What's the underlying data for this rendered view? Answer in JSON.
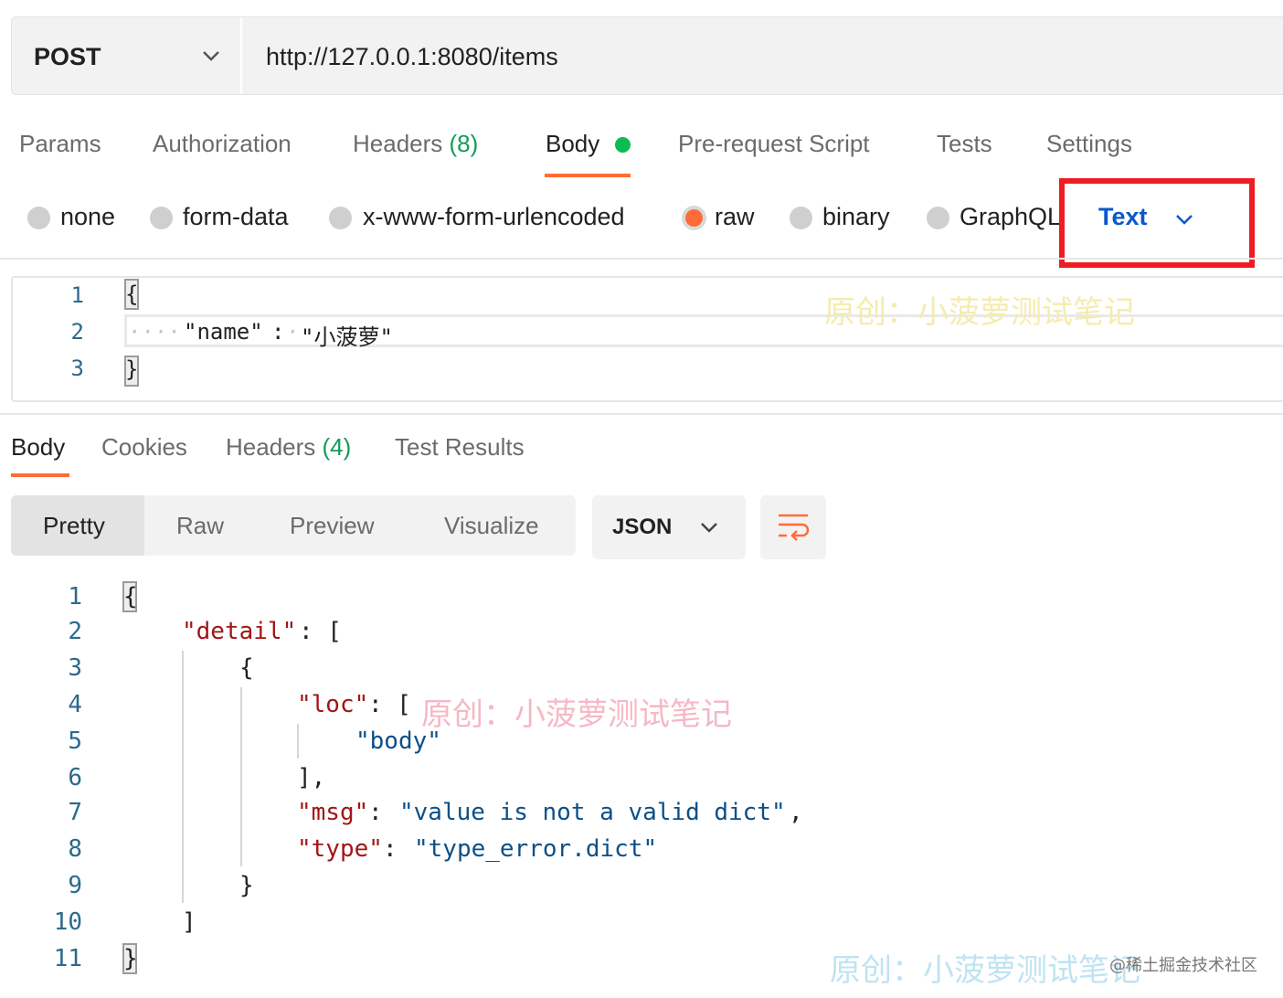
{
  "request": {
    "method": "POST",
    "url": "http://127.0.0.1:8080/items"
  },
  "request_tabs": [
    {
      "label": "Params"
    },
    {
      "label": "Authorization"
    },
    {
      "label": "Headers",
      "count": "(8)"
    },
    {
      "label": "Body",
      "active": true
    },
    {
      "label": "Pre-request Script"
    },
    {
      "label": "Tests"
    },
    {
      "label": "Settings"
    }
  ],
  "body_types": [
    {
      "label": "none",
      "selected": false
    },
    {
      "label": "form-data",
      "selected": false
    },
    {
      "label": "x-www-form-urlencoded",
      "selected": false
    },
    {
      "label": "raw",
      "selected": true
    },
    {
      "label": "binary",
      "selected": false
    },
    {
      "label": "GraphQL",
      "selected": false
    }
  ],
  "raw_format": "Text",
  "request_body": {
    "line_numbers": [
      "1",
      "2",
      "3"
    ],
    "line1": "{",
    "line2_key": "\"name\"",
    "line2_sep": ":",
    "line2_value": "\"小菠萝\"",
    "line3": "}"
  },
  "response_tabs": [
    {
      "label": "Body",
      "active": true
    },
    {
      "label": "Cookies"
    },
    {
      "label": "Headers",
      "count": "(4)"
    },
    {
      "label": "Test Results"
    }
  ],
  "view_modes": [
    "Pretty",
    "Raw",
    "Preview",
    "Visualize"
  ],
  "active_view_mode": "Pretty",
  "response_format": "JSON",
  "response_body": {
    "line_numbers": [
      "1",
      "2",
      "3",
      "4",
      "5",
      "6",
      "7",
      "8",
      "9",
      "10",
      "11"
    ],
    "detail_key": "\"detail\"",
    "loc_key": "\"loc\"",
    "loc_value": "\"body\"",
    "msg_key": "\"msg\"",
    "msg_value": "\"value is not a valid dict\"",
    "type_key": "\"type\"",
    "type_value": "\"type_error.dict\""
  },
  "watermarks": {
    "author": "原创：小菠萝测试笔记",
    "site": "@稀土掘金技术社区"
  },
  "colors": {
    "accent": "#ff6c37",
    "highlight_box": "#ee1d23",
    "link_blue": "#0a58ca",
    "count_green": "#0f9d58"
  }
}
